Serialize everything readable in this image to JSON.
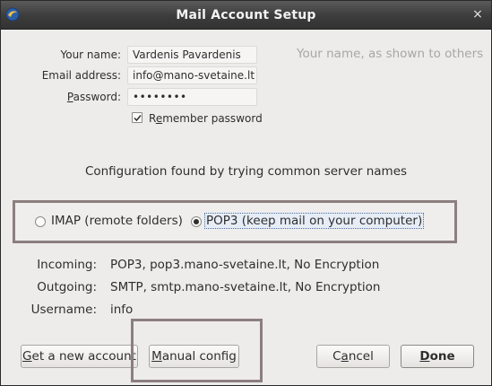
{
  "window": {
    "title": "Mail Account Setup",
    "close_symbol": "×"
  },
  "form": {
    "name_label": "Your name:",
    "name_value": "Vardenis Pavardenis",
    "name_hint": "Your name, as shown to others",
    "email_label": "Email address:",
    "email_value": "info@mano-svetaine.lt",
    "password_label": "Password:",
    "password_value": "••••••••",
    "remember_label": "Remember password",
    "remember_checked": true
  },
  "status_text": "Configuration found by trying common server names",
  "protocol": {
    "imap_label": "IMAP (remote folders)",
    "pop3_label": "POP3 (keep mail on your computer)",
    "selected": "pop3"
  },
  "server_info": {
    "incoming_label": "Incoming:",
    "incoming_value": "POP3, pop3.mano-svetaine.lt, No Encryption",
    "outgoing_label": "Outgoing:",
    "outgoing_value": "SMTP, smtp.mano-svetaine.lt, No Encryption",
    "username_label": "Username:",
    "username_value": "info"
  },
  "buttons": {
    "get_account_first": "G",
    "get_account_rest": "et a new account",
    "manual_first": "M",
    "manual_rest": "anual config",
    "cancel_before": "C",
    "cancel_access": "a",
    "cancel_after": "ncel",
    "done_first": "D",
    "done_rest": "one"
  },
  "icons": {
    "app": "thunderbird-icon",
    "close": "close-icon",
    "checkbox": "checkmark-icon"
  }
}
